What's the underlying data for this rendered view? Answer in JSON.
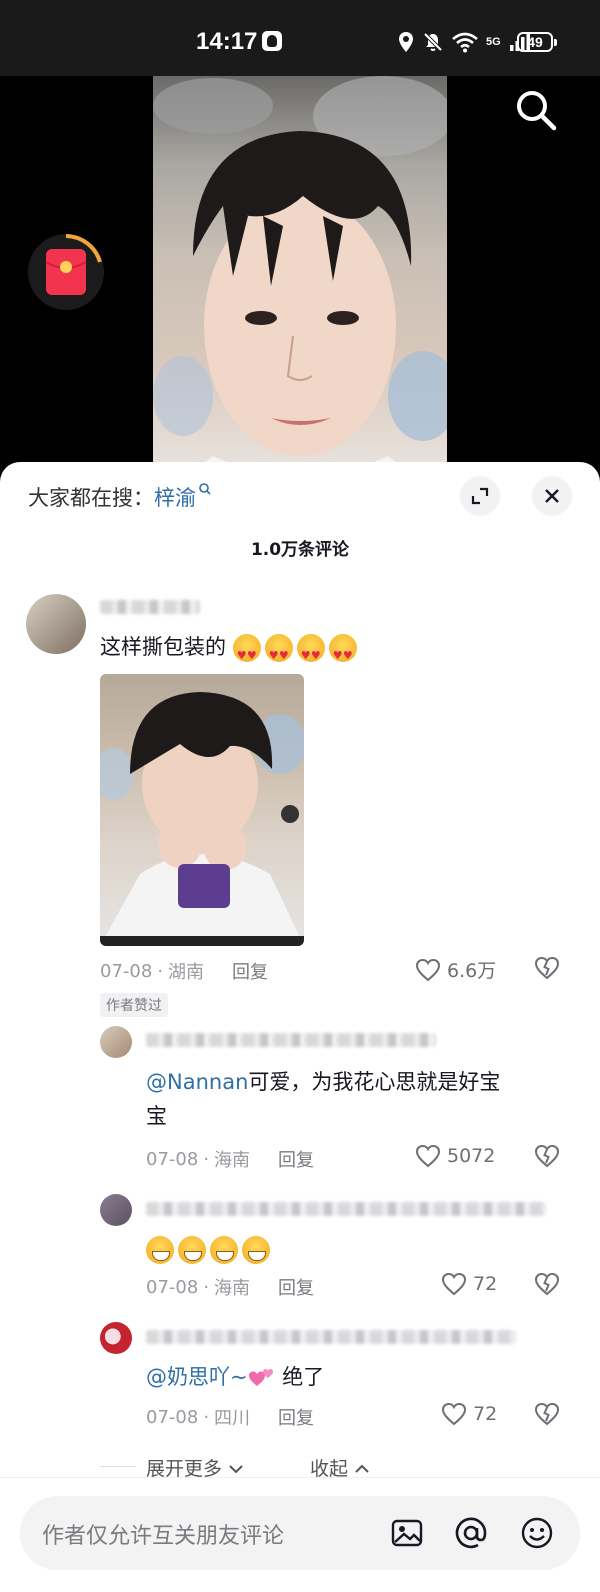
{
  "status_bar": {
    "time": "14:17",
    "network": "5G",
    "battery": "49"
  },
  "hot_search": {
    "prefix": "大家都在搜：",
    "term": "梓渝"
  },
  "comments": {
    "count_label": "1.0万条评论",
    "top": {
      "text": "这样撕包装的",
      "emoji_count": 4,
      "date": "07-08",
      "location": "湖南",
      "reply_label": "回复",
      "likes": "6.6万",
      "author_badge": "作者赞过"
    },
    "replies": [
      {
        "mention": "@Nannan",
        "text_line1": "可爱，为我花心思就是好宝",
        "text_line2": "宝",
        "date": "07-08",
        "location": "海南",
        "reply_label": "回复",
        "likes": "5072"
      },
      {
        "emoji_count": 4,
        "date": "07-08",
        "location": "海南",
        "reply_label": "回复",
        "likes": "72"
      },
      {
        "mention": "@奶思吖~",
        "text": " 绝了",
        "date": "07-08",
        "location": "四川",
        "reply_label": "回复",
        "likes": "72"
      }
    ],
    "expand_more": "展开更多",
    "collapse": "收起"
  },
  "input": {
    "placeholder": "作者仅允许互关朋友评论"
  },
  "colors": {
    "mention": "#2f6ea7",
    "meta": "#9a9aa0",
    "heart_emoji": "#e8283f"
  }
}
